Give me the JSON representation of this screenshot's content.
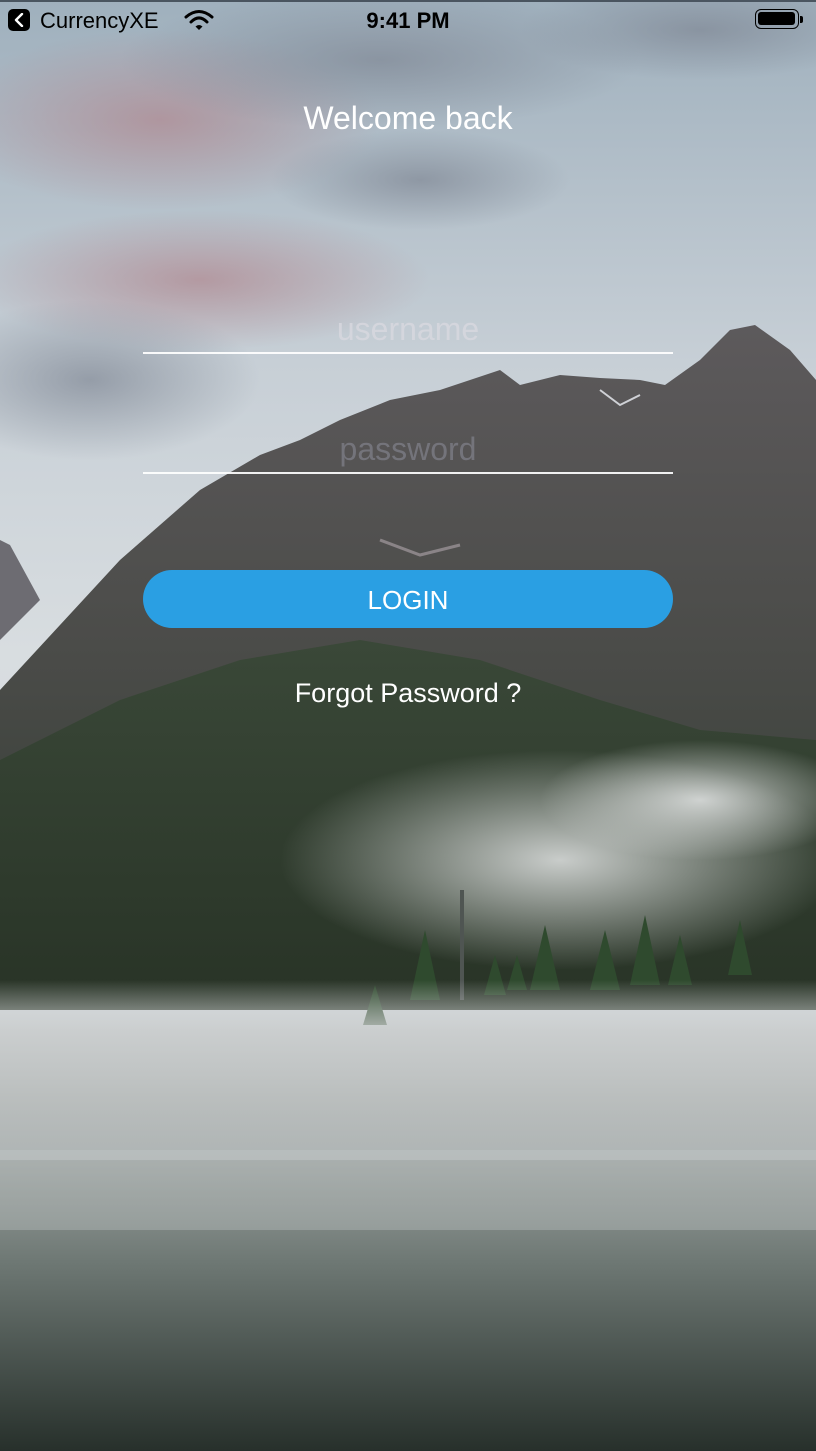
{
  "status_bar": {
    "back_app": "CurrencyXE",
    "time": "9:41 PM",
    "battery_level": 1.0
  },
  "login": {
    "title": "Welcome back",
    "username_placeholder": "username",
    "password_placeholder": "password",
    "login_label": "LOGIN",
    "forgot_label": "Forgot Password ?"
  },
  "colors": {
    "accent": "#2a9fe3"
  }
}
